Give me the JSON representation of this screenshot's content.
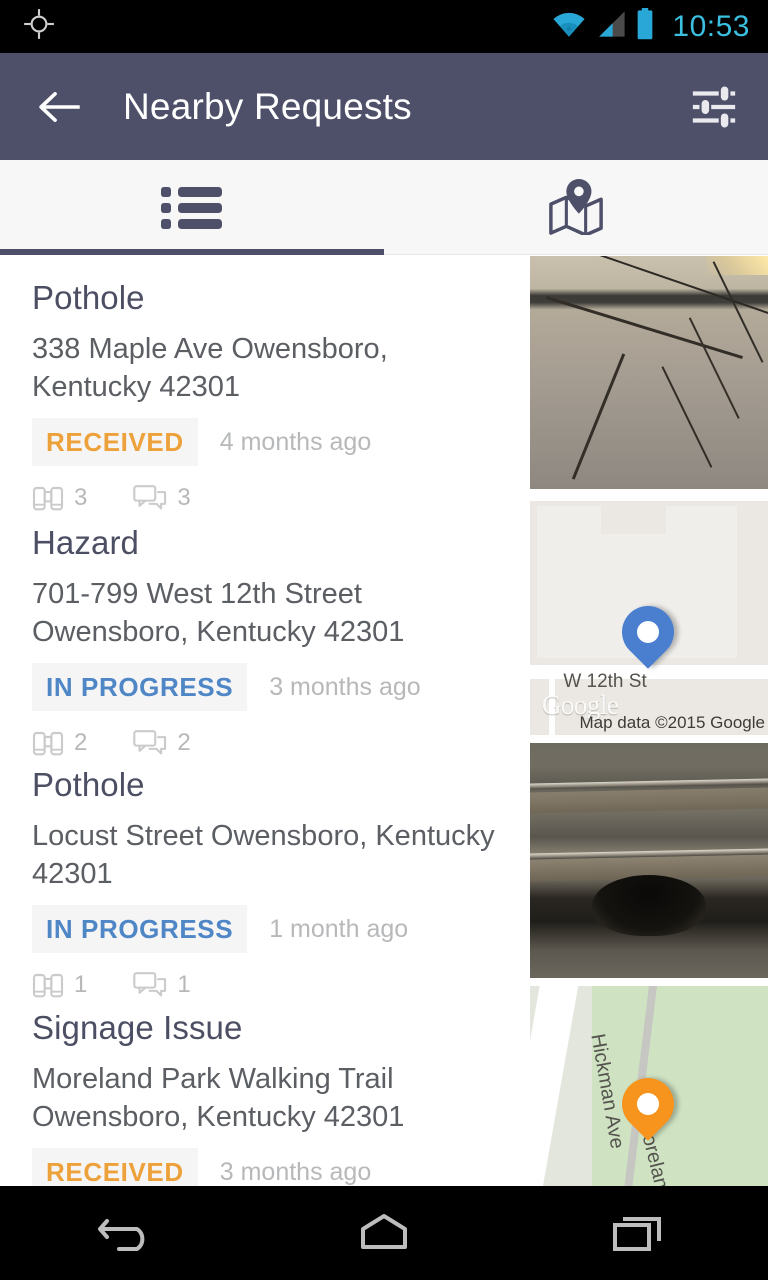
{
  "status_bar": {
    "time": "10:53",
    "icons": [
      "location-crosshair-icon",
      "wifi-icon",
      "cell-signal-icon",
      "battery-icon"
    ]
  },
  "app_bar": {
    "title": "Nearby Requests",
    "back_icon": "back-arrow-icon",
    "filter_icon": "filter-sliders-icon"
  },
  "tabs": [
    {
      "icon": "list-icon",
      "name": "list",
      "active": true
    },
    {
      "icon": "map-pin-icon",
      "name": "map",
      "active": false
    }
  ],
  "requests": [
    {
      "title": "Pothole",
      "address": "338  Maple Ave Owensboro, Kentucky 42301",
      "status": "RECEIVED",
      "status_kind": "received",
      "age": "4 months ago",
      "watchers": "3",
      "comments": "3",
      "thumb_kind": "photo-crack"
    },
    {
      "title": "Hazard",
      "address": "701-799  West 12th Street Owensboro, Kentucky 42301",
      "status": "IN PROGRESS",
      "status_kind": "in-progress",
      "age": "3 months ago",
      "watchers": "2",
      "comments": "2",
      "thumb_kind": "map-beige",
      "map": {
        "street_label": "W 12th St",
        "watermark": "Google",
        "attribution": "Map data ©2015 Google",
        "pin_color": "#4a7fd0"
      }
    },
    {
      "title": "Pothole",
      "address": "Locust Street Owensboro, Kentucky 42301",
      "status": "IN PROGRESS",
      "status_kind": "in-progress",
      "age": "1 month ago",
      "watchers": "1",
      "comments": "1",
      "thumb_kind": "photo-rail"
    },
    {
      "title": "Signage Issue",
      "address": "Moreland Park Walking Trail Owensboro, Kentucky 42301",
      "status": "RECEIVED",
      "status_kind": "received",
      "age": "3 months ago",
      "watchers": "",
      "comments": "",
      "thumb_kind": "map-green",
      "map": {
        "street_label": "Hickman Ave",
        "street_label_2": "Moreland P",
        "pin_color": "#f7941e"
      }
    }
  ],
  "nav_bar": {
    "back": "nav-back-icon",
    "home": "nav-home-icon",
    "recents": "nav-recents-icon"
  },
  "colors": {
    "app_bar": "#4d5068",
    "accent_received": "#eda13a",
    "accent_in_progress": "#4f86c6",
    "title": "#4c4f63",
    "clock": "#3bbfe0"
  }
}
